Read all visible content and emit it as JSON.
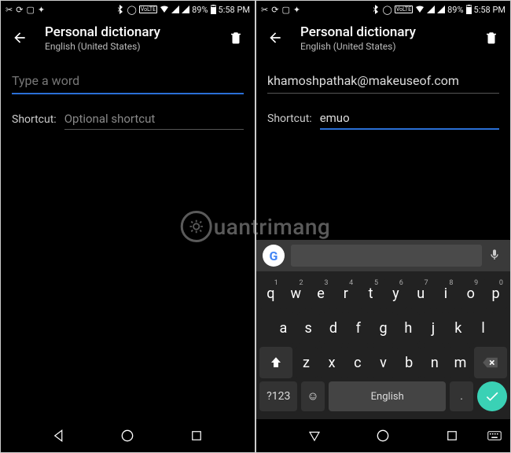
{
  "status": {
    "battery": "89%",
    "time": "5:58 PM",
    "volte": "VoLTE"
  },
  "header": {
    "title": "Personal dictionary",
    "subtitle": "English (United States)"
  },
  "left": {
    "word_placeholder": "Type a word",
    "word_value": "",
    "shortcut_label": "Shortcut:",
    "shortcut_placeholder": "Optional shortcut",
    "shortcut_value": ""
  },
  "right": {
    "word_value": "khamoshpathak@makeuseof.com",
    "shortcut_label": "Shortcut:",
    "shortcut_value": "emuo"
  },
  "keyboard": {
    "row1": [
      {
        "k": "q",
        "s": "1"
      },
      {
        "k": "w",
        "s": "2"
      },
      {
        "k": "e",
        "s": "3"
      },
      {
        "k": "r",
        "s": "4"
      },
      {
        "k": "t",
        "s": "5"
      },
      {
        "k": "y",
        "s": "6"
      },
      {
        "k": "u",
        "s": "7"
      },
      {
        "k": "i",
        "s": "8"
      },
      {
        "k": "o",
        "s": "9"
      },
      {
        "k": "p",
        "s": "0"
      }
    ],
    "row2": [
      "a",
      "s",
      "d",
      "f",
      "g",
      "h",
      "j",
      "k",
      "l"
    ],
    "row3": [
      "z",
      "x",
      "c",
      "v",
      "b",
      "n",
      "m"
    ],
    "symbols": "?123",
    "space": "English",
    "period": "."
  },
  "watermark": "uantrimang"
}
